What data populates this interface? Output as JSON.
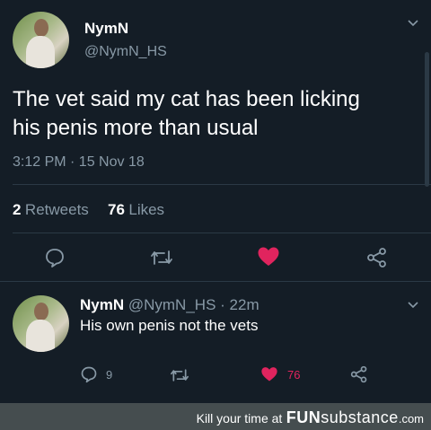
{
  "tweet": {
    "author_name": "NymN",
    "author_handle": "@NymN_HS",
    "text_line1": "The vet said my cat has been licking",
    "text_line2": "his penis more than usual",
    "timestamp": "3:12 PM · 15 Nov 18",
    "retweets_count": "2",
    "retweets_label": "Retweets",
    "likes_count": "76",
    "likes_label": "Likes",
    "liked": true
  },
  "reply": {
    "author_name": "NymN",
    "author_handle": "@NymN_HS",
    "separator": "·",
    "time_ago": "22m",
    "text": "His own penis not the vets",
    "reply_count": "9",
    "like_count": "76",
    "liked": true
  },
  "footer": {
    "text": "Kill your time at",
    "brand_prefix": "FUN",
    "brand_suffix": "substance",
    "brand_tld": ".com"
  },
  "colors": {
    "background": "#141d26",
    "secondary_text": "#8899a6",
    "like_red": "#e0245e",
    "divider": "#2b3945"
  },
  "icons": [
    "chevron-down-icon",
    "reply-icon",
    "retweet-icon",
    "heart-icon",
    "share-icon"
  ]
}
